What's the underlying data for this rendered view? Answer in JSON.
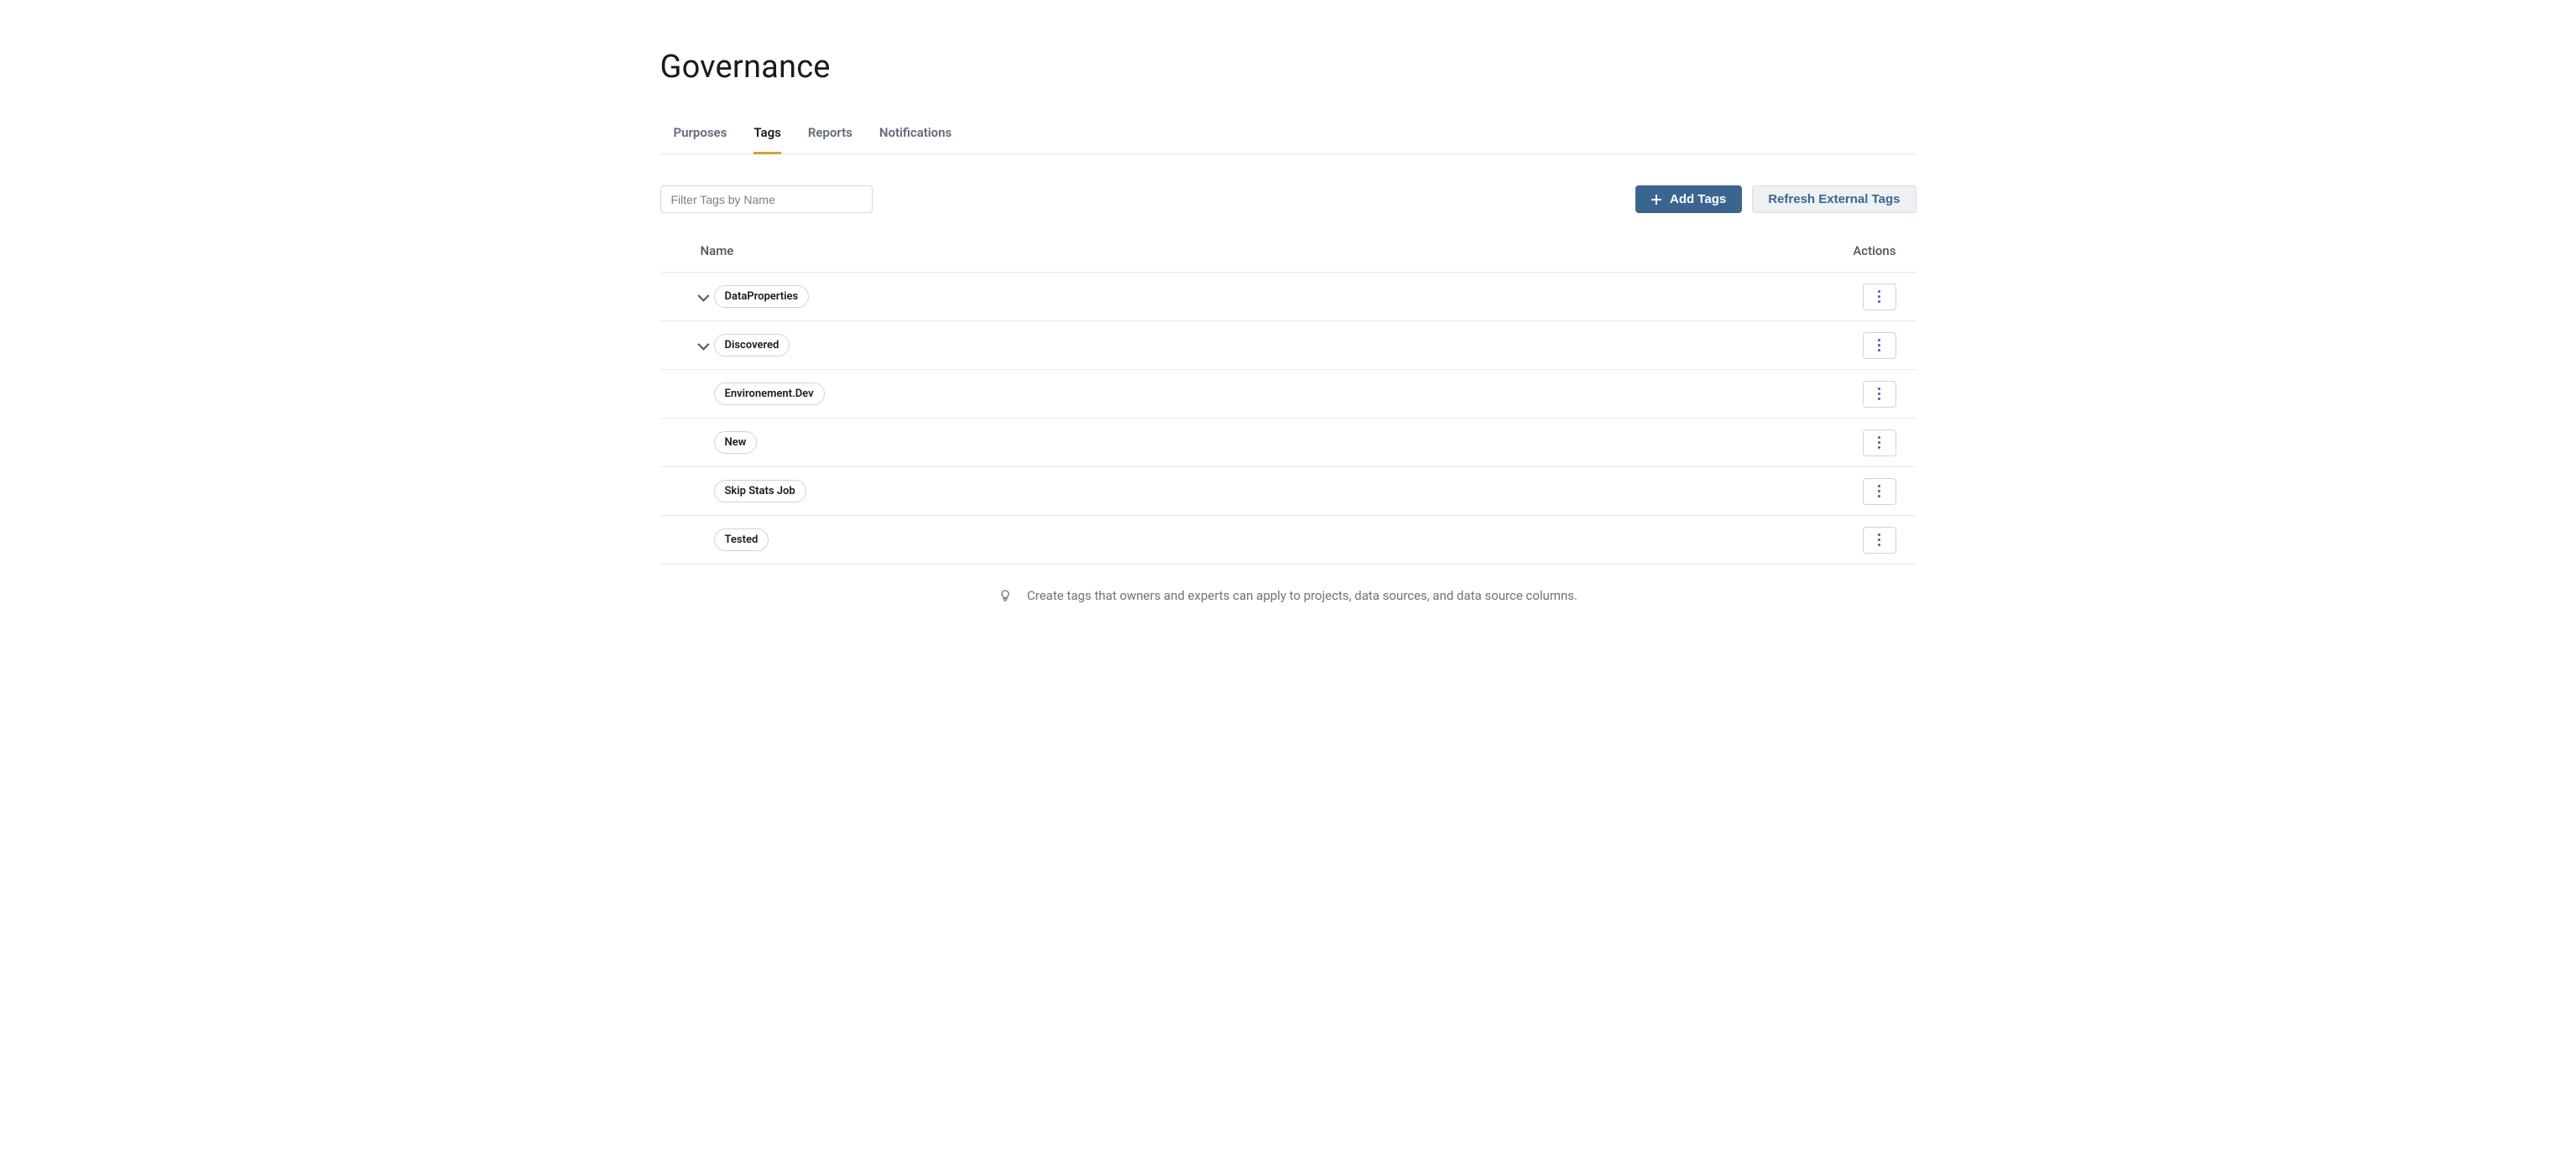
{
  "page": {
    "title": "Governance"
  },
  "tabs": {
    "purposes": "Purposes",
    "tags": "Tags",
    "reports": "Reports",
    "notifications": "Notifications",
    "active": "tags"
  },
  "toolbar": {
    "filter_placeholder": "Filter Tags by Name",
    "filter_value": "",
    "add_tags_label": "Add Tags",
    "refresh_label": "Refresh External Tags"
  },
  "table": {
    "columns": {
      "name": "Name",
      "actions": "Actions"
    },
    "rows": [
      {
        "name": "DataProperties",
        "expandable": true
      },
      {
        "name": "Discovered",
        "expandable": true
      },
      {
        "name": "Environement.Dev",
        "expandable": false
      },
      {
        "name": "New",
        "expandable": false
      },
      {
        "name": "Skip Stats Job",
        "expandable": false
      },
      {
        "name": "Tested",
        "expandable": false
      }
    ]
  },
  "hint": {
    "text": "Create tags that owners and experts can apply to projects, data sources, and data source columns."
  }
}
